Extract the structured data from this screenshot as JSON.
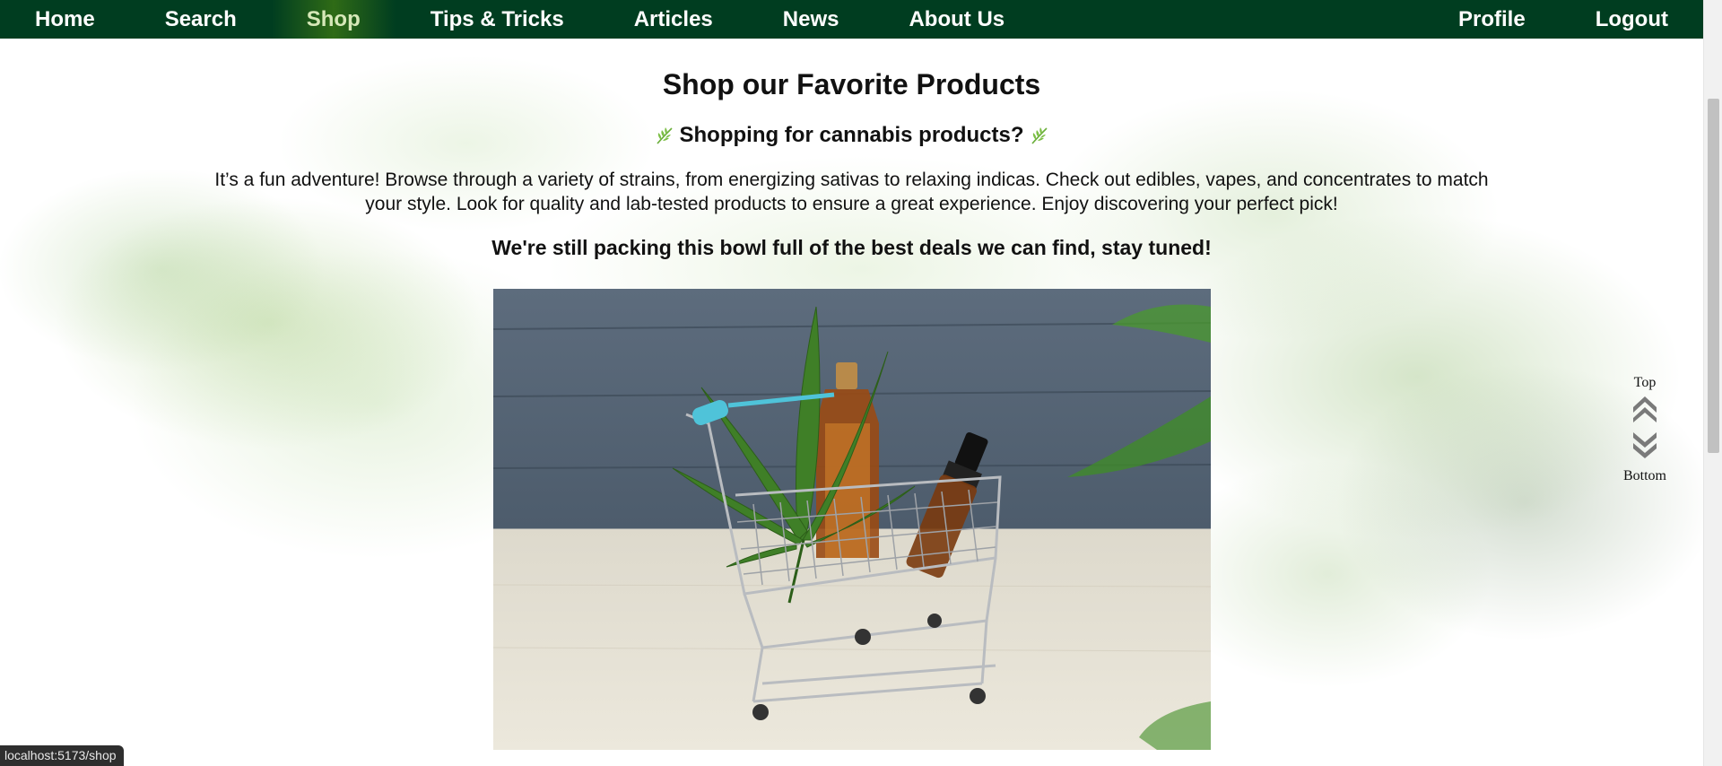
{
  "nav": {
    "left": [
      {
        "label": "Home"
      },
      {
        "label": "Search"
      },
      {
        "label": "Shop"
      },
      {
        "label": "Tips & Tricks"
      },
      {
        "label": "Articles"
      },
      {
        "label": "News"
      },
      {
        "label": "About Us"
      }
    ],
    "right": [
      {
        "label": "Profile"
      },
      {
        "label": "Logout"
      }
    ],
    "active": "Shop"
  },
  "page": {
    "title": "Shop our Favorite Products",
    "subtitle": "Shopping for cannabis products?",
    "description": "It’s a fun adventure! Browse through a variety of strains, from energizing sativas to relaxing indicas. Check out edibles, vapes, and concentrates to match your style. Look for quality and lab-tested products to ensure a great experience. Enjoy discovering your perfect pick!",
    "tagline": "We're still packing this bowl full of the best deals we can find, stay tuned!"
  },
  "scroll_control": {
    "top_label": "Top",
    "bottom_label": "Bottom"
  },
  "status_bar": {
    "url": "localhost:5173/shop"
  },
  "colors": {
    "nav_bg": "#003d20",
    "active_tab": "#2f6b16",
    "leaf": "#7cbf45"
  },
  "icons": {
    "subtitle_icons": "leaf-icon",
    "scroll_up": "chevron-double-up-icon",
    "scroll_down": "chevron-double-down-icon"
  }
}
